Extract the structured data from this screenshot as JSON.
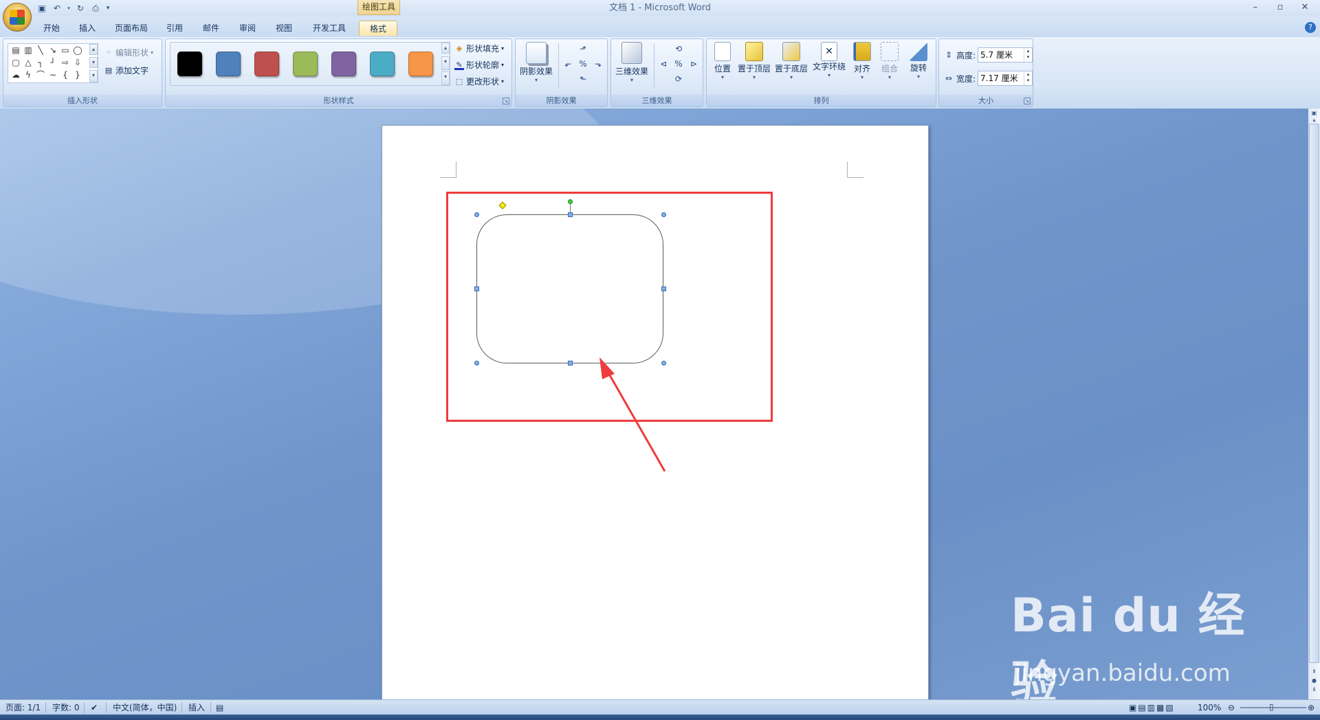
{
  "window": {
    "title": "文档 1 - Microsoft Word",
    "contextual_group": "绘图工具",
    "controls": [
      "–",
      "▫",
      "✕"
    ]
  },
  "quick_access": {
    "icons": [
      "save-icon",
      "undo-icon",
      "redo-icon",
      "print-preview-icon",
      "customize-icon"
    ]
  },
  "tabs": [
    "开始",
    "插入",
    "页面布局",
    "引用",
    "邮件",
    "审阅",
    "视图",
    "开发工具",
    "格式"
  ],
  "active_tab": "格式",
  "ribbon": {
    "insert_shapes": {
      "label": "插入形状",
      "edit_shape": "编辑形状",
      "add_text": "添加文字"
    },
    "shape_styles": {
      "label": "形状样式",
      "swatches": [
        "#000000",
        "#4f81bd",
        "#c0504d",
        "#9bbb59",
        "#8064a2",
        "#4bacc6",
        "#f79646"
      ],
      "fill": "形状填充",
      "outline": "形状轮廓",
      "change": "更改形状"
    },
    "shadow": {
      "label": "阴影效果",
      "button": "阴影效果"
    },
    "three_d": {
      "label": "三维效果",
      "button": "三维效果"
    },
    "arrange": {
      "label": "排列",
      "buttons": [
        "位置",
        "置于顶层",
        "置于底层",
        "文字环绕",
        "对齐",
        "组合",
        "旋转"
      ]
    },
    "size": {
      "label": "大小",
      "height_label": "高度:",
      "height_value": "5.7 厘米",
      "width_label": "宽度:",
      "width_value": "7.17 厘米"
    }
  },
  "status": {
    "page": "页面: 1/1",
    "words": "字数: 0",
    "language": "中文(简体，中国)",
    "mode": "插入",
    "zoom": "100%"
  },
  "watermark": {
    "logo": "Bai du 经验",
    "url": "jingyan.baidu.com"
  },
  "colors": {
    "highlight": "#ef3b3b",
    "accent": "#2b5797"
  }
}
